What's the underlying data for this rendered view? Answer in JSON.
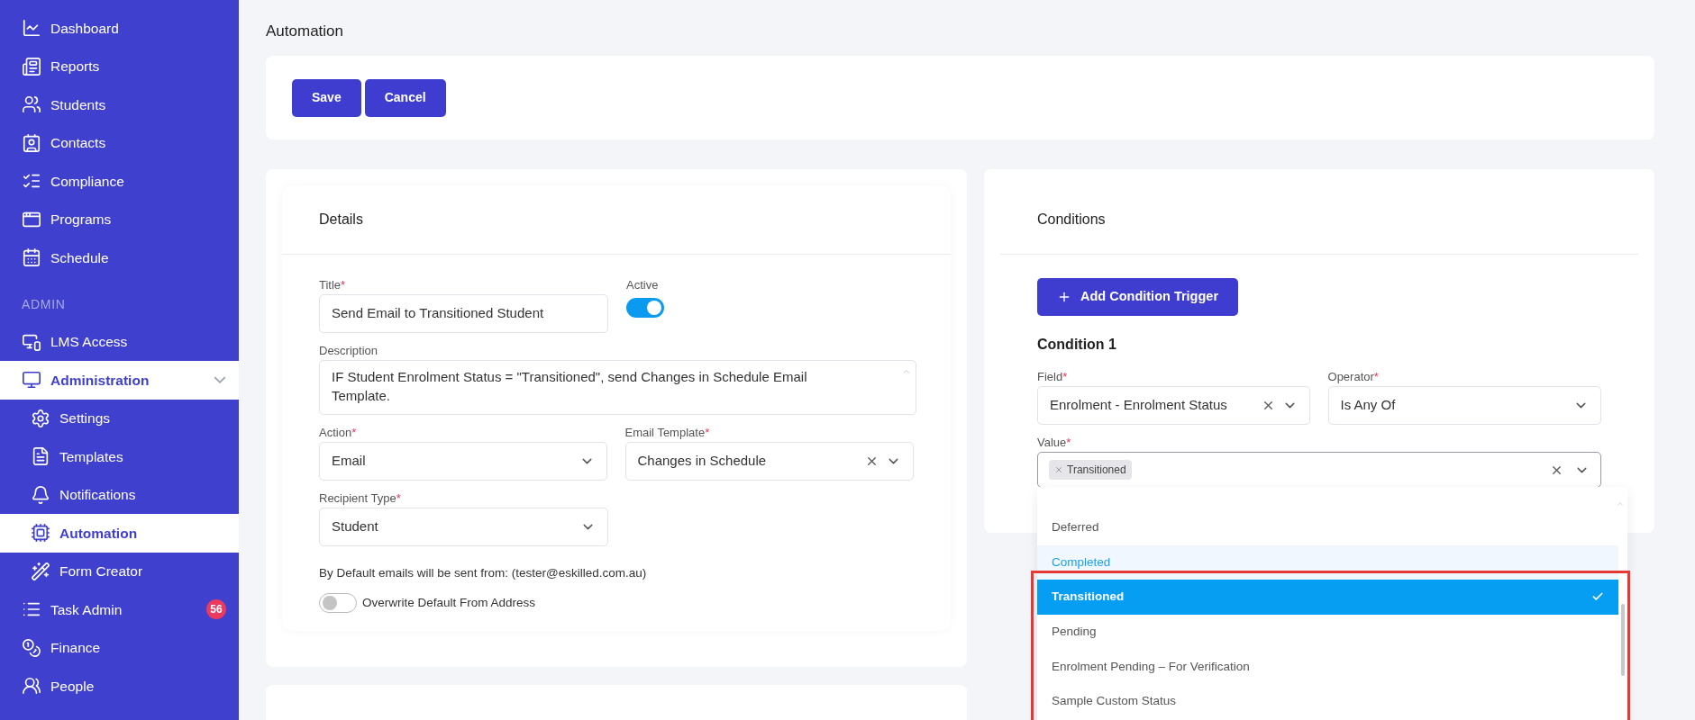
{
  "sidebar": {
    "main_items": [
      {
        "label": "Dashboard",
        "selected": false
      },
      {
        "label": "Reports",
        "selected": false
      },
      {
        "label": "Students",
        "selected": false
      },
      {
        "label": "Contacts",
        "selected": false
      },
      {
        "label": "Compliance",
        "selected": false
      },
      {
        "label": "Programs",
        "selected": false
      },
      {
        "label": "Schedule",
        "selected": false
      }
    ],
    "section_heading": "ADMIN",
    "admin_items": [
      {
        "label": "LMS Access",
        "selected": false
      },
      {
        "label": "Administration",
        "selected": true,
        "expanded": true,
        "children": [
          {
            "label": "Settings",
            "selected": false
          },
          {
            "label": "Templates",
            "selected": false
          },
          {
            "label": "Notifications",
            "selected": false
          },
          {
            "label": "Automation",
            "selected": true
          },
          {
            "label": "Form Creator",
            "selected": false
          }
        ]
      },
      {
        "label": "Task Admin",
        "selected": false,
        "badge": "56"
      },
      {
        "label": "Finance",
        "selected": false
      },
      {
        "label": "People",
        "selected": false
      }
    ]
  },
  "page_title": "Automation",
  "actions": [
    "Save",
    "Cancel"
  ],
  "details": {
    "heading": "Details",
    "title": {
      "label": "Title",
      "required_mark": "*",
      "value": "Send Email to Transitioned Student"
    },
    "active": {
      "label": "Active",
      "on": true
    },
    "description": {
      "label": "Description",
      "value": "IF Student Enrolment Status = \"Transitioned\", send Changes in Schedule Email Template."
    },
    "action": {
      "label": "Action",
      "required_mark": "*",
      "value": "Email",
      "clearable": false
    },
    "email_template": {
      "label": "Email Template",
      "required_mark": "*",
      "value": "Changes in Schedule",
      "clearable": true
    },
    "recipient_type": {
      "label": "Recipient Type",
      "required_mark": "*",
      "value": "Student",
      "clearable": false
    },
    "note": "By Default emails will be sent from: (tester@eskilled.com.au)",
    "overwrite": {
      "label": "Overwrite Default From Address",
      "on": false
    }
  },
  "conditions": {
    "heading": "Conditions",
    "add_button": "Add Condition Trigger",
    "condition_title": "Condition 1",
    "field": {
      "label": "Field",
      "required_mark": "*",
      "value": "Enrolment - Enrolment Status",
      "clearable": true
    },
    "operator": {
      "label": "Operator",
      "required_mark": "*",
      "value": "Is Any Of",
      "clearable": false
    },
    "value": {
      "label": "Value",
      "required_mark": "*",
      "tags": [
        "Transitioned"
      ]
    },
    "options": [
      {
        "label": "Deferred",
        "selected": false,
        "highlighted": false
      },
      {
        "label": "Completed",
        "selected": false,
        "highlighted": true
      },
      {
        "label": "Transitioned",
        "selected": true,
        "highlighted": false
      },
      {
        "label": "Pending",
        "selected": false,
        "highlighted": false
      },
      {
        "label": "Enrolment Pending – For Verification",
        "selected": false,
        "highlighted": false
      },
      {
        "label": "Sample Custom Status",
        "selected": false,
        "highlighted": false
      }
    ]
  }
}
